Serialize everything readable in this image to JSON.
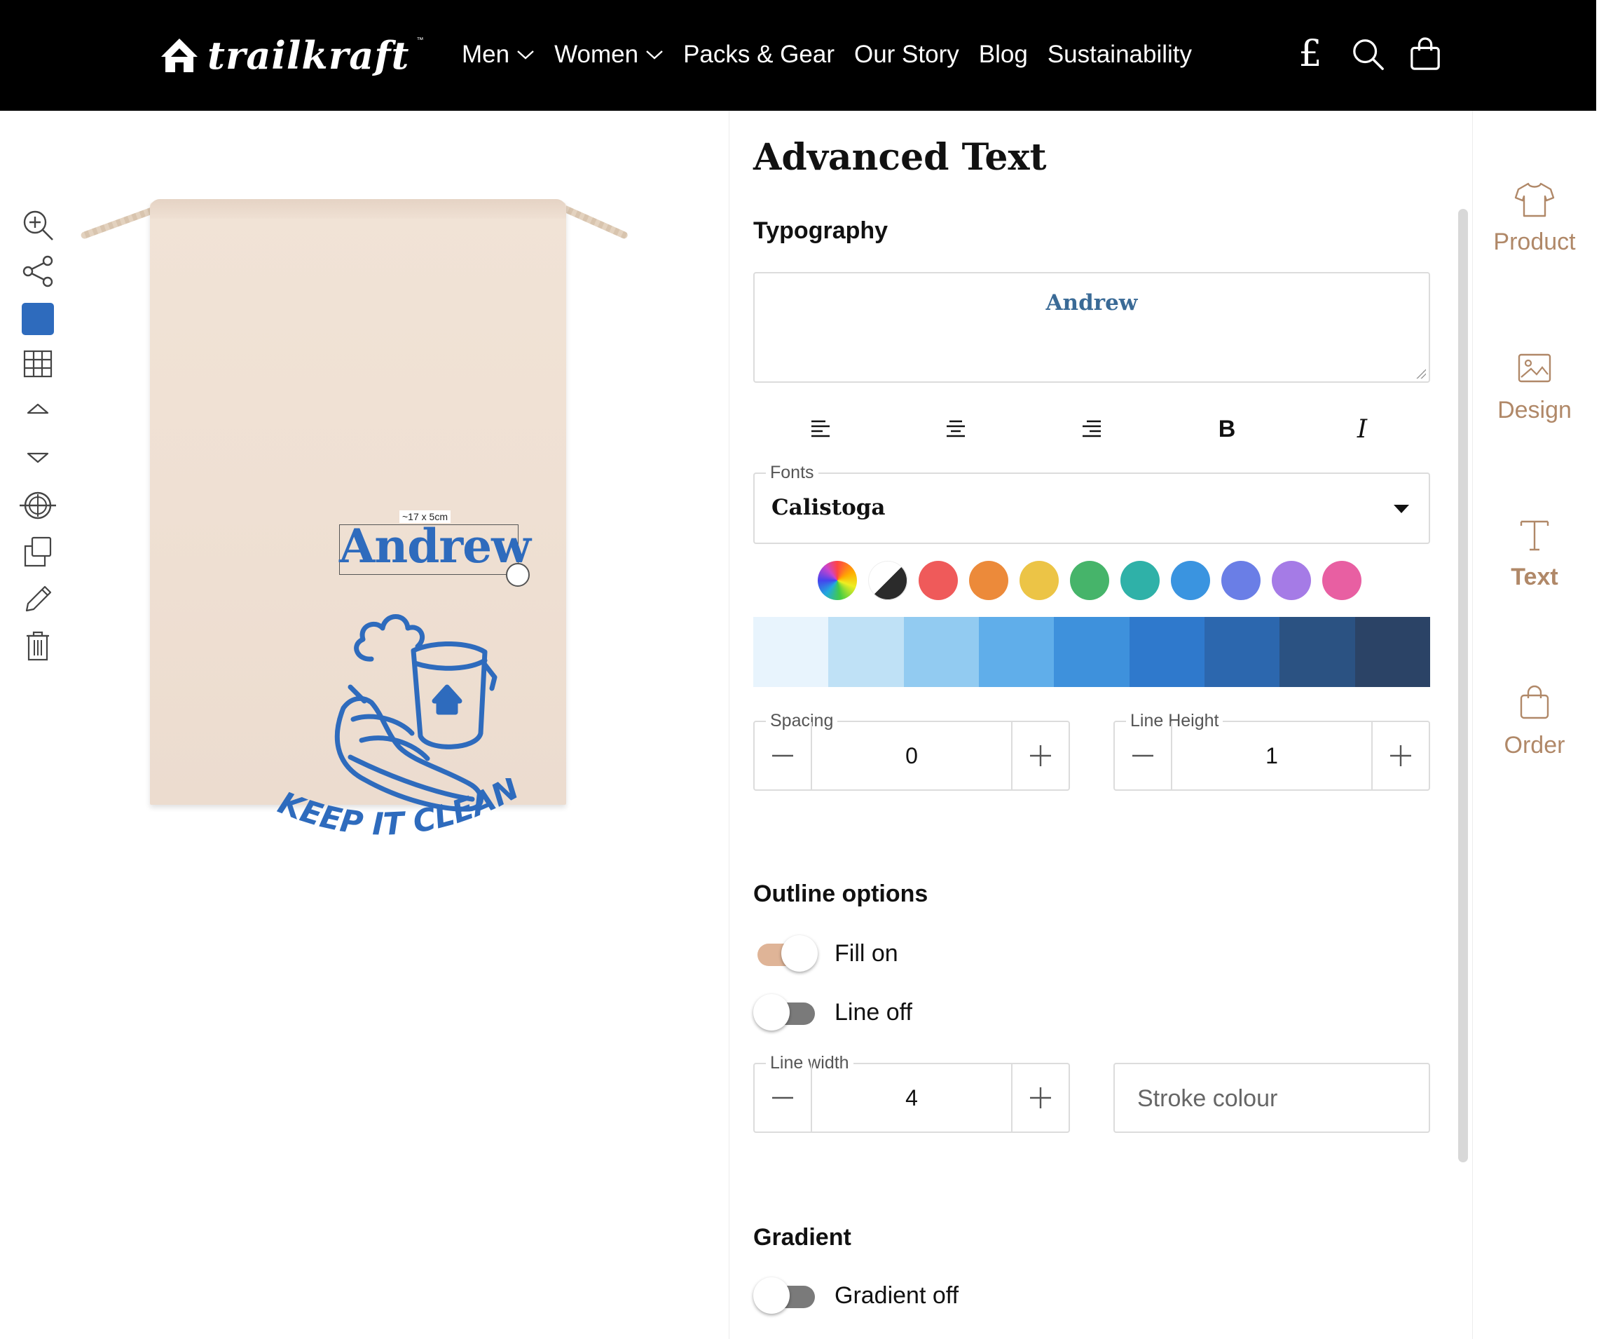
{
  "brand": {
    "name": "trailkraft",
    "tm": "™"
  },
  "nav": {
    "items": [
      {
        "label": "Men",
        "has_dropdown": true
      },
      {
        "label": "Women",
        "has_dropdown": true
      },
      {
        "label": "Packs & Gear",
        "has_dropdown": false
      },
      {
        "label": "Our Story",
        "has_dropdown": false
      },
      {
        "label": "Blog",
        "has_dropdown": false
      },
      {
        "label": "Sustainability",
        "has_dropdown": false
      }
    ],
    "currency_symbol": "£",
    "icons": [
      "search-icon",
      "shopping-bag-icon"
    ]
  },
  "tools": [
    {
      "name": "zoom-in-icon"
    },
    {
      "name": "share-icon"
    },
    {
      "name": "color-swatch",
      "color": "#2e6bbd"
    },
    {
      "name": "grid-icon"
    },
    {
      "name": "bring-forward-icon"
    },
    {
      "name": "send-backward-icon"
    },
    {
      "name": "center-align-icon"
    },
    {
      "name": "duplicate-icon"
    },
    {
      "name": "edit-pencil-icon"
    },
    {
      "name": "trash-icon"
    }
  ],
  "canvas": {
    "size_label": "~17 x 5cm",
    "text_on_product": "Andrew",
    "design_text": "KEEP IT CLEAN!",
    "ink_color": "#2e6bbd",
    "product_color": "#efe0d3"
  },
  "panel": {
    "title": "Advanced Text",
    "typography": {
      "heading": "Typography",
      "text_value": "Andrew",
      "format_buttons": [
        "align-left-icon",
        "align-center-icon",
        "align-right-icon",
        "bold-icon",
        "italic-icon"
      ],
      "bold_label": "B",
      "italic_label": "I",
      "fonts_label": "Fonts",
      "font_value": "Calistoga"
    },
    "palette": {
      "colors": [
        "rainbow",
        "#2b2b2b",
        "#ef5a5a",
        "#ec8a3a",
        "#ecc446",
        "#46b46a",
        "#2fb1a8",
        "#3a94e0",
        "#6a7ee6",
        "#a57be6",
        "#e85fa2"
      ],
      "shades": [
        "#e8f4fd",
        "#bfe1f6",
        "#92cbf1",
        "#60aeea",
        "#3e91dc",
        "#2f79cc",
        "#2c67ae",
        "#2b5282",
        "#2b4366"
      ]
    },
    "spacing": {
      "label": "Spacing",
      "value": "0"
    },
    "line_height": {
      "label": "Line Height",
      "value": "1"
    },
    "outline": {
      "heading": "Outline options",
      "fill": {
        "label": "Fill on",
        "on": true
      },
      "line": {
        "label": "Line off",
        "on": false
      },
      "line_width": {
        "label": "Line width",
        "value": "4"
      },
      "stroke_placeholder": "Stroke colour"
    },
    "gradient": {
      "heading": "Gradient",
      "toggle": {
        "label": "Gradient off",
        "on": false
      }
    }
  },
  "rail": {
    "items": [
      {
        "label": "Product",
        "icon": "tshirt-icon",
        "active": false
      },
      {
        "label": "Design",
        "icon": "image-icon",
        "active": false
      },
      {
        "label": "Text",
        "icon": "text-icon",
        "active": true
      },
      {
        "label": "Order",
        "icon": "bag-icon",
        "active": false
      }
    ],
    "accent": "#b08868"
  }
}
